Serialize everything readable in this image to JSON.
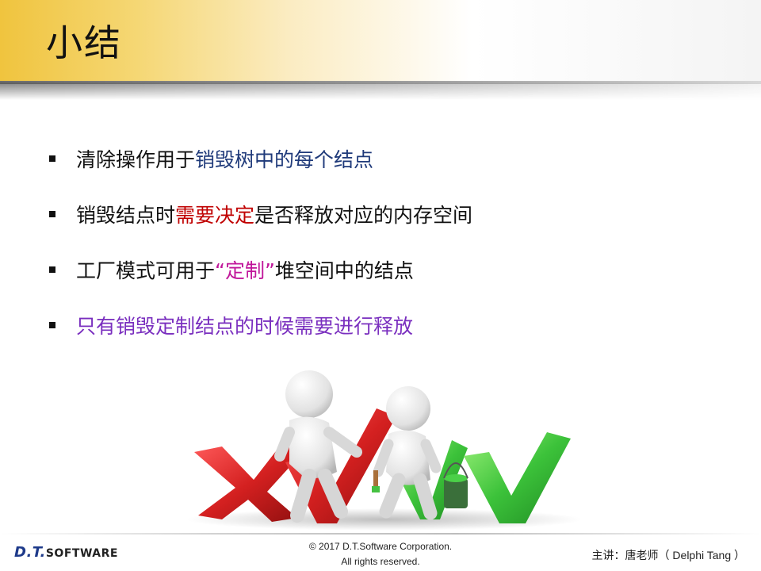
{
  "slide": {
    "title": "小结",
    "bullets": [
      {
        "parts": [
          {
            "text": "清除操作用于",
            "color": "#111111"
          },
          {
            "text": "销毁树中的每个结点",
            "color": "#1f3a7a"
          }
        ]
      },
      {
        "parts": [
          {
            "text": "销毁结点时",
            "color": "#111111"
          },
          {
            "text": "需要决定",
            "color": "#c00000"
          },
          {
            "text": "是否释放对应的内存空间",
            "color": "#111111"
          }
        ]
      },
      {
        "parts": [
          {
            "text": "工厂模式可用于",
            "color": "#111111"
          },
          {
            "text": "“定制”",
            "color": "#c0169a"
          },
          {
            "text": "堆空间中的结点",
            "color": "#111111"
          }
        ]
      },
      {
        "parts": [
          {
            "text": "只有销毁定制结点的时候需要进行释放",
            "color": "#7a2fbf"
          }
        ]
      }
    ]
  },
  "footer": {
    "logo_main": "D.T.",
    "logo_sub": "SOFTWARE",
    "copyright_line1": "© 2017 D.T.Software Corporation.",
    "copyright_line2": "All rights reserved.",
    "speaker": "主讲：唐老师（ Delphi Tang ）"
  },
  "illustration": {
    "icon": "people-painting-checkmarks-illustration",
    "colors": {
      "cross": "#d42020",
      "check": "#3cc23a",
      "figure": "#e6e6e6"
    }
  }
}
